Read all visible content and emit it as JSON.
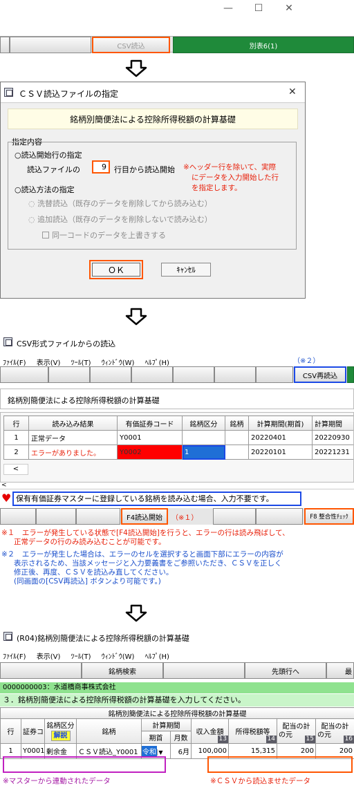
{
  "step1": {
    "buttons": {
      "csv": "CSV読込",
      "sheet6": "別表6(1)"
    },
    "colors": {
      "accent_orange": "#ff5500",
      "sheet_green": "#1f8a3a"
    }
  },
  "dialog": {
    "title": "ＣＳＶ読込ファイルの指定",
    "banner": "銘柄別簡便法による控除所得税額の計算基礎",
    "group_label": "指定内容",
    "opt_start_row": "○読込開始行の指定",
    "start_prefix": "読込ファイルの",
    "start_value": "9",
    "start_suffix": "行目から読込開始",
    "note_lines": [
      "※ヘッダー行を除いて、実際",
      "にデータを入力開始した行",
      "を指定します。"
    ],
    "opt_method": "○読込方法の指定",
    "radio_overwrite": "洗替読込（既存のデータを削除してから読み込む）",
    "radio_append": "追加読込（既存のデータを削除しないで読み込む）",
    "check_same_code": "同一コードのデータを上書きする",
    "ok": "ＯＫ",
    "cancel": "ｷｬﾝｾﾙ"
  },
  "csv_window": {
    "title": "CSV形式ファイルからの読込",
    "menu": [
      "ﾌｧｲﾙ(F)",
      "表示(V)",
      "ﾂｰﾙ(T)",
      "ｳｨﾝﾄﾞｳ(W)",
      "ﾍﾙﾌﾟ(H)"
    ],
    "note2": "（※２）",
    "reload_button": "CSV再読込",
    "caption": "銘柄別簡便法による控除所得税額の計算基礎",
    "columns": [
      "行",
      "読み込み結果",
      "有価証券コード",
      "銘柄区分",
      "銘柄",
      "計算期間(期首)",
      "計算期間"
    ],
    "rows": [
      {
        "no": "1",
        "result": "正常データ",
        "code": "Y0001",
        "kubun": "",
        "meigara": "",
        "start": "20220401",
        "end": "20220930"
      },
      {
        "no": "2",
        "result": "エラーがありました。",
        "code": "Y0002",
        "kubun": "1",
        "meigara": "",
        "start": "20220101",
        "end": "20221231"
      }
    ],
    "heart": "♥",
    "hint": "保有有価証券マスターに登録している銘柄を読み込む場合、入力不要です。",
    "f4_button": "F4読込開始",
    "note1": "（※１）",
    "f8_button": "F8 整合性ﾁｪｯｸ",
    "footnotes": {
      "n1_mark": "※１",
      "n1_line1": "エラーが発生している状態で[F4読込開始]を行うと、エラーの行は読み飛ばして、",
      "n1_line2": "正常データの行のみ読み込むことが可能です。",
      "n2_mark": "※２",
      "n2_line1": "エラーが発生した場合は、エラーのセルを選択すると画面下部にエラーの内容が",
      "n2_line2": "表示されるため、当該メッセージと入力要義書をご参照いただき、ＣＳＶを正しく",
      "n2_line3": "修正後、再度、ＣＳＶを読込み直してください。",
      "n2_line4": "(同画面の[CSV再読込] ボタンより可能です。)"
    }
  },
  "final_window": {
    "title": "(R04)銘柄別簡便法による控除所得税額の計算基礎",
    "menu": [
      "ﾌｧｲﾙ(F)",
      "表示(V)",
      "ﾂｰﾙ(T)",
      "ｳｨﾝﾄﾞｳ(W)",
      "ﾍﾙﾌﾟ(H)"
    ],
    "btn_search": "銘柄検索",
    "btn_first": "先頭行へ",
    "btn_partial": "最",
    "company": "0000000003：水道橋商事株式会社",
    "instruction": "３．銘柄別簡便法による控除所得税額の計算基礎を入力してください。",
    "table_title": "銘柄別簡便法による控除所得税額の計算基礎",
    "headers": {
      "row": "行",
      "code": "証券コ",
      "kubun": "銘柄区分",
      "kaisetsu": "解説",
      "meigara": "銘柄",
      "period": "計算期間",
      "kishu": "期首",
      "months": "月数",
      "income": "収入金額",
      "income_no": "13",
      "tax": "所得税額等",
      "tax_no": "14",
      "c15": "配当の計",
      "c15_sub": "の元",
      "c15_no": "15",
      "c16": "配当の計",
      "c16_sub": "の元",
      "c16_no": "16"
    },
    "row": {
      "no": "1",
      "code": "Y0001",
      "kubun": "剰余金",
      "meigara": "ＣＳＶ読込_Y0001",
      "era": "令和",
      "months": "6月",
      "income": "100,000",
      "tax": "15,315",
      "c15": "200",
      "c16": "200"
    },
    "note_master": "※マスターから連動されたデータ",
    "note_csv": "※ＣＳＶから読込ませたデータ"
  }
}
